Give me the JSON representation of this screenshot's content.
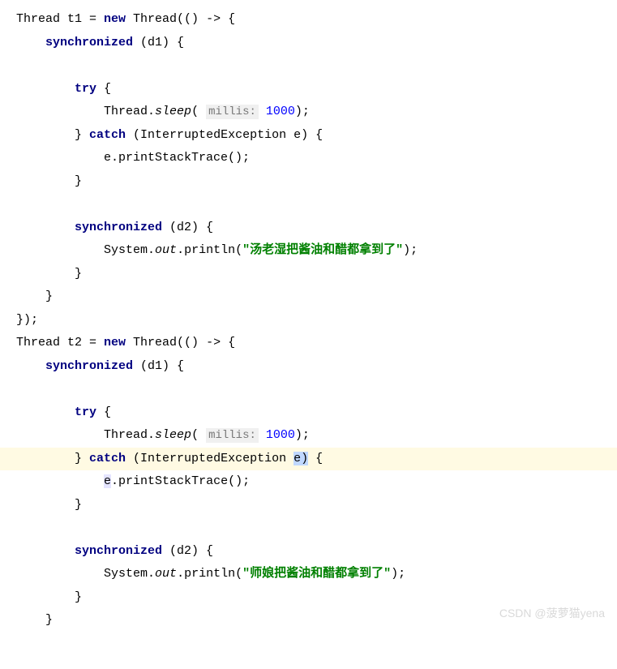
{
  "code": {
    "line1": {
      "prefix": "Thread t1 = ",
      "kw_new": "new",
      "rest": " Thread(() -> {"
    },
    "line2": {
      "kw_sync": "synchronized",
      "rest": " (d1) {"
    },
    "line3": "",
    "line4": {
      "kw_try": "try",
      "rest": " {"
    },
    "line5": {
      "prefix": "Thread.",
      "method": "sleep",
      "open": "( ",
      "hint": "millis:",
      "space": " ",
      "num": "1000",
      "close": ");"
    },
    "line6": {
      "prefix": "} ",
      "kw_catch": "catch",
      "rest": " (InterruptedException e) {"
    },
    "line7": {
      "text": "e.printStackTrace();"
    },
    "line8": {
      "text": "}"
    },
    "line9": "",
    "line10": {
      "kw_sync": "synchronized",
      "rest": " (d2) {"
    },
    "line11": {
      "prefix": "System.",
      "out": "out",
      "mid": ".println(",
      "str": "\"汤老湿把酱油和醋都拿到了\"",
      "close": ");"
    },
    "line12": {
      "text": "}"
    },
    "line13": {
      "text": "}"
    },
    "line14": {
      "text": "});"
    },
    "line15": {
      "prefix": "Thread t2 = ",
      "kw_new": "new",
      "rest": " Thread(() -> {"
    },
    "line16": {
      "kw_sync": "synchronized",
      "rest": " (d1) {"
    },
    "line17": "",
    "line18": {
      "kw_try": "try",
      "rest": " {"
    },
    "line19": {
      "prefix": "Thread.",
      "method": "sleep",
      "open": "( ",
      "hint": "millis:",
      "space": " ",
      "num": "1000",
      "close": ");"
    },
    "line20": {
      "prefix": "} ",
      "kw_catch": "catch",
      "rest1": " (InterruptedException ",
      "var": "e",
      "paren": ")",
      "rest2": " {"
    },
    "line21": {
      "var": "e",
      "text": ".printStackTrace();"
    },
    "line22": {
      "text": "}"
    },
    "line23": "",
    "line24": {
      "kw_sync": "synchronized",
      "rest": " (d2) {"
    },
    "line25": {
      "prefix": "System.",
      "out": "out",
      "mid": ".println(",
      "str": "\"师娘把酱油和醋都拿到了\"",
      "close": ");"
    },
    "line26": {
      "text": "}"
    },
    "line27": {
      "text": "}"
    }
  },
  "watermark": "CSDN @菠萝猫yena"
}
